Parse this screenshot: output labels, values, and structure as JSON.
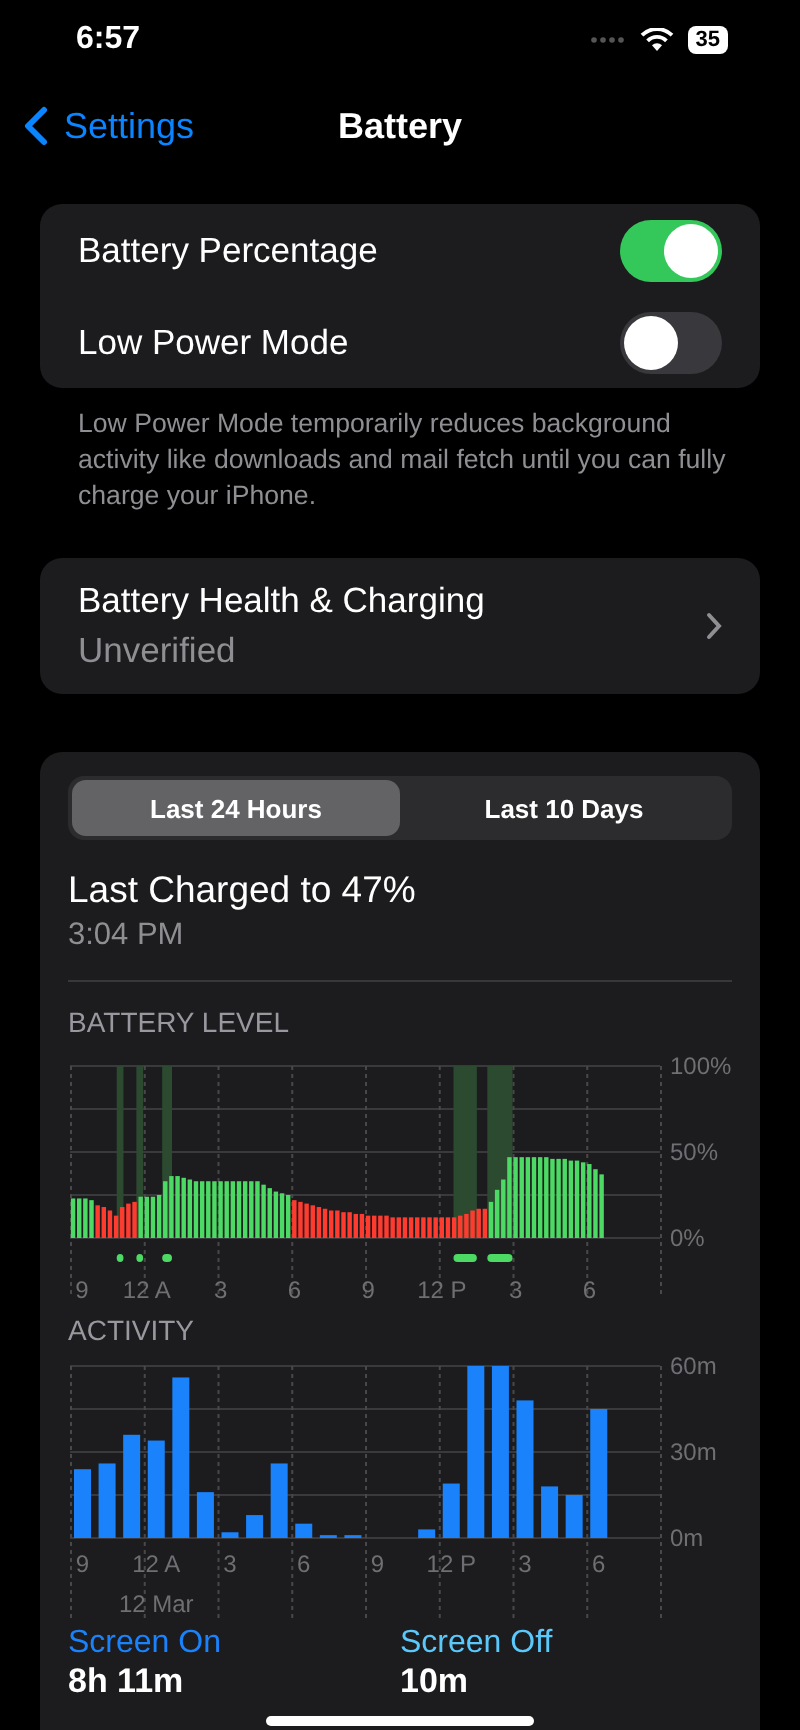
{
  "status_bar": {
    "time": "6:57",
    "battery": "35"
  },
  "nav": {
    "back": "Settings",
    "title": "Battery"
  },
  "toggles": [
    {
      "label": "Battery Percentage",
      "on": true
    },
    {
      "label": "Low Power Mode",
      "on": false
    }
  ],
  "footnote": "Low Power Mode temporarily reduces background activity like downloads and mail fetch until you can fully charge your iPhone.",
  "health": {
    "title": "Battery Health & Charging",
    "value": "Unverified"
  },
  "usage": {
    "tabs": [
      {
        "label": "Last 24 Hours",
        "selected": true
      },
      {
        "label": "Last 10 Days",
        "selected": false
      }
    ],
    "last_charged": "Last Charged to 47%",
    "charged_time": "3:04 PM",
    "battery_chart": {
      "chart_data": {
        "type": "bar",
        "title": "BATTERY LEVEL",
        "ylim": [
          0,
          100
        ],
        "categories": [
          "9",
          null,
          null,
          null,
          null,
          null,
          null,
          null,
          null,
          null,
          null,
          null,
          "12 A",
          null,
          null,
          null,
          null,
          null,
          null,
          null,
          null,
          null,
          null,
          null,
          "3",
          null,
          null,
          null,
          null,
          null,
          null,
          null,
          null,
          null,
          null,
          null,
          "6",
          null,
          null,
          null,
          null,
          null,
          null,
          null,
          null,
          null,
          null,
          null,
          "9",
          null,
          null,
          null,
          null,
          null,
          null,
          null,
          null,
          null,
          null,
          null,
          "12 P",
          null,
          null,
          null,
          null,
          null,
          null,
          null,
          null,
          null,
          null,
          null,
          "3",
          null,
          null,
          null,
          null,
          null,
          null,
          null,
          null,
          null,
          null,
          null,
          "6",
          null,
          null,
          null,
          null,
          null,
          null,
          null,
          null,
          null,
          null,
          null
        ],
        "yticks": [
          {
            "value": 0,
            "label": "0%"
          },
          {
            "value": 50,
            "label": "50%"
          },
          {
            "value": 100,
            "label": "100%"
          }
        ],
        "series": [
          {
            "color": "#4cd964",
            "values": [
              23,
              23,
              23,
              22,
              null,
              null,
              null,
              null,
              null,
              null,
              null,
              24,
              24,
              24,
              25,
              33,
              36,
              36,
              35,
              34,
              33,
              33,
              33,
              33,
              33,
              33,
              33,
              33,
              33,
              33,
              33,
              31,
              29,
              27,
              26,
              25,
              null,
              null,
              null,
              null,
              null,
              null,
              null,
              null,
              null,
              null,
              null,
              null,
              null,
              null,
              null,
              null,
              null,
              null,
              null,
              null,
              null,
              null,
              null,
              null,
              null,
              null,
              null,
              null,
              null,
              null,
              null,
              null,
              21,
              28,
              34,
              47,
              47,
              47,
              47,
              47,
              47,
              47,
              46,
              46,
              46,
              45,
              45,
              44,
              43,
              40,
              37,
              null,
              null,
              null,
              null,
              null,
              null,
              null,
              null,
              null
            ]
          },
          {
            "color": "#ff3b30",
            "values": [
              null,
              null,
              null,
              null,
              19,
              18,
              16,
              13,
              18,
              20,
              21,
              null,
              null,
              null,
              null,
              null,
              null,
              null,
              null,
              null,
              null,
              null,
              null,
              null,
              null,
              null,
              null,
              null,
              null,
              null,
              null,
              null,
              null,
              null,
              null,
              null,
              22,
              21,
              20,
              19,
              18,
              17,
              16,
              16,
              15,
              15,
              14,
              14,
              13,
              13,
              13,
              13,
              12,
              12,
              12,
              12,
              12,
              12,
              12,
              12,
              12,
              12,
              12,
              13,
              14,
              16,
              17,
              17,
              null,
              null,
              null,
              null,
              null,
              null,
              null,
              null,
              null,
              null,
              null,
              null,
              null,
              null,
              null,
              null,
              null,
              null,
              null,
              null,
              null,
              null,
              null,
              null,
              null,
              null,
              null,
              null
            ]
          }
        ],
        "stacked": true
      }
    },
    "activity_chart": {
      "chart_data": {
        "type": "bar",
        "title": "ACTIVITY",
        "ylim": [
          0,
          60
        ],
        "categories": [
          "9",
          null,
          null,
          "12 A",
          null,
          null,
          "3",
          null,
          null,
          "6",
          null,
          null,
          "9",
          null,
          null,
          "12 P",
          null,
          null,
          "3",
          null,
          null,
          "6",
          null,
          null
        ],
        "yticks": [
          {
            "value": 0,
            "label": "0m"
          },
          {
            "value": 30,
            "label": "30m"
          },
          {
            "value": 60,
            "label": "60m"
          }
        ],
        "series": [
          {
            "color": "#1a82fb",
            "values": [
              24,
              26,
              36,
              34,
              56,
              16,
              2,
              8,
              26,
              5,
              1,
              1,
              0,
              0,
              3,
              19,
              60,
              60,
              48,
              18,
              15,
              45,
              null,
              null
            ]
          }
        ],
        "annotations": [
          "12 Mar"
        ]
      }
    },
    "stats": [
      {
        "label": "Screen On",
        "value": "8h 11m",
        "color": "#1a82fb"
      },
      {
        "label": "Screen Off",
        "value": "10m",
        "color": "#5ac8fa"
      }
    ]
  }
}
